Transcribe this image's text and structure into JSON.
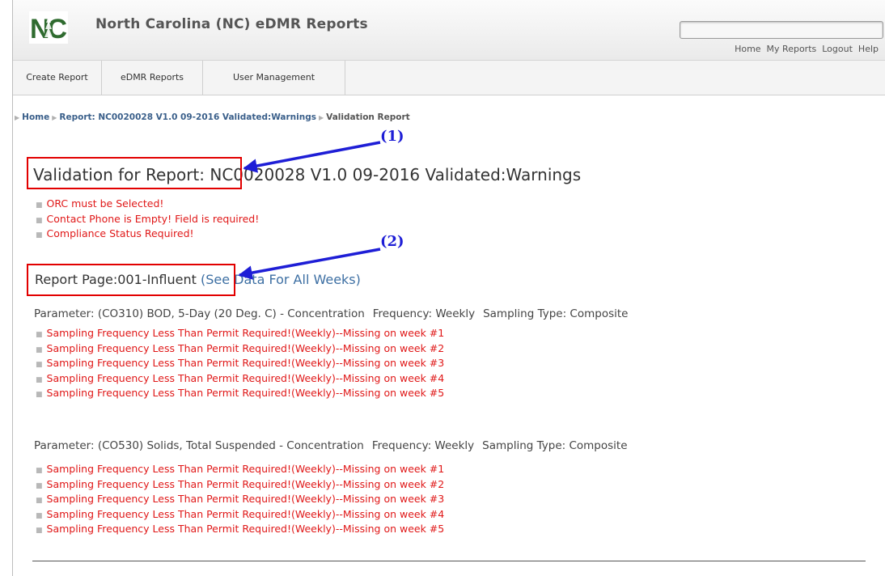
{
  "header": {
    "logo_text": "NC",
    "app_title": "North Carolina (NC) eDMR Reports",
    "search_value": "",
    "top_links": [
      "Home",
      "My Reports",
      "Logout",
      "Help"
    ]
  },
  "nav": {
    "tabs": [
      "Create Report",
      "eDMR Reports",
      "User Management"
    ]
  },
  "breadcrumb": {
    "home": "Home",
    "report": "Report: NC0020028 V1.0 09-2016 Validated:Warnings",
    "current": "Validation Report"
  },
  "page": {
    "title_label": "Validation for Report:",
    "title_value": " NC0020028 V1.0 09-2016 Validated:Warnings",
    "report_errors": [
      "ORC must be Selected!",
      "Contact Phone is Empty! Field is required!",
      "Compliance Status Required!"
    ],
    "section": {
      "label": "Report Page:001-Influent",
      "see_all_link": "(See Data For All Weeks)"
    },
    "parameters": [
      {
        "name": "Parameter: (CO310) BOD, 5-Day (20 Deg. C) - Concentration",
        "frequency": "Frequency: Weekly",
        "sampling": "Sampling Type: Composite",
        "messages": [
          "Sampling Frequency Less Than Permit Required!(Weekly)--Missing on week #1",
          "Sampling Frequency Less Than Permit Required!(Weekly)--Missing on week #2",
          "Sampling Frequency Less Than Permit Required!(Weekly)--Missing on week #3",
          "Sampling Frequency Less Than Permit Required!(Weekly)--Missing on week #4",
          "Sampling Frequency Less Than Permit Required!(Weekly)--Missing on week #5"
        ]
      },
      {
        "name": "Parameter: (CO530) Solids, Total Suspended - Concentration",
        "frequency": "Frequency: Weekly",
        "sampling": "Sampling Type: Composite",
        "messages": [
          "Sampling Frequency Less Than Permit Required!(Weekly)--Missing on week #1",
          "Sampling Frequency Less Than Permit Required!(Weekly)--Missing on week #2",
          "Sampling Frequency Less Than Permit Required!(Weekly)--Missing on week #3",
          "Sampling Frequency Less Than Permit Required!(Weekly)--Missing on week #4",
          "Sampling Frequency Less Than Permit Required!(Weekly)--Missing on week #5"
        ]
      }
    ]
  },
  "annotations": {
    "callout_1": "(1)",
    "callout_2": "(2)",
    "box_color": "#e20000",
    "arrow_color": "#1e1ed6"
  }
}
